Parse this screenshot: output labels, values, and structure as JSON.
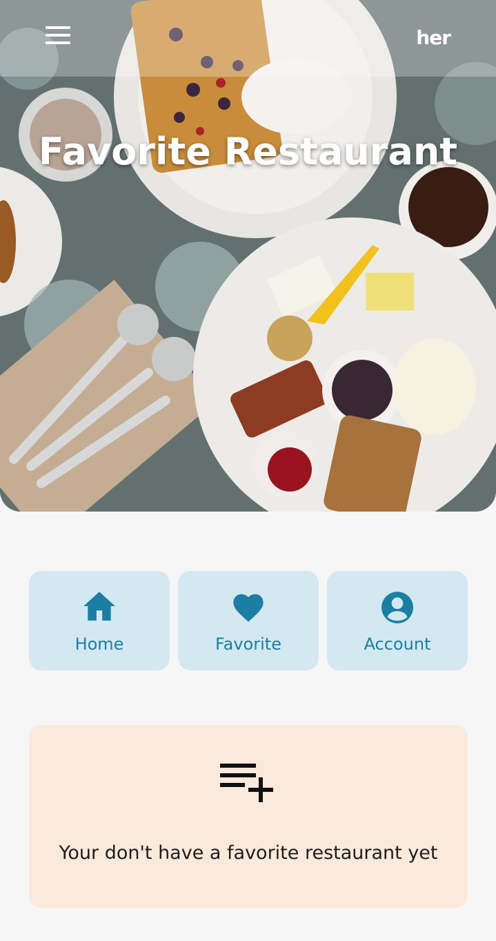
{
  "header": {
    "brand": "her",
    "menu_icon": "hamburger-menu-icon",
    "title": "Favorite Restaurant"
  },
  "nav": {
    "items": [
      {
        "label": "Home",
        "icon": "home-icon"
      },
      {
        "label": "Favorite",
        "icon": "heart-icon"
      },
      {
        "label": "Account",
        "icon": "account-circle-icon"
      }
    ]
  },
  "empty_state": {
    "icon": "playlist-add-icon",
    "message": "Your don't have a favorite restaurant yet"
  },
  "colors": {
    "accent": "#1a7fa3",
    "tile_bg": "#d3e8f1",
    "empty_bg": "#faeadb",
    "page_bg": "#f6f6f6"
  }
}
